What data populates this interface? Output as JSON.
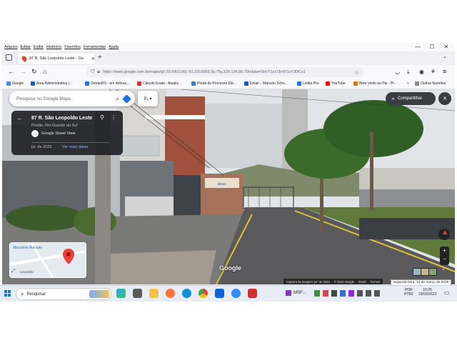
{
  "menubar": {
    "items": [
      "Arquivo",
      "Editar",
      "Exibir",
      "Histórico",
      "Favoritos",
      "Ferramentas",
      "Ajuda"
    ]
  },
  "browser": {
    "tab_title": "87 R. São Leopoldo Leste - Go",
    "url": "https://www.google.com.br/maps/@-29.6901183,-51.2310669,3a,75y,329.13h,89.79t/data=!3m7!1e1!3m5!1sY3DCs1",
    "bookmarks": [
      {
        "label": "Google",
        "color": "#4285f4"
      },
      {
        "label": "Área Administrativa |...",
        "color": "#1565c0"
      },
      {
        "label": "DetranRS - em defesa...",
        "color": "#1a73e8"
      },
      {
        "label": "Cálculo Exato - Atualiz...",
        "color": "#d93025"
      },
      {
        "label": "Portal do Processo Ele...",
        "color": "#3c78d8"
      },
      {
        "label": "Email – Marcelo Scho...",
        "color": "#0b57d0"
      },
      {
        "label": "Leilão Pro",
        "color": "#1a73e8"
      },
      {
        "label": "YouTube",
        "color": "#ff0000"
      },
      {
        "label": "Bem-vindo ao Pie - Pr...",
        "color": "#e37400"
      }
    ],
    "other_favorites": "Outros favoritos"
  },
  "maps": {
    "search_placeholder": "Pesquise no Google Maps",
    "share_label": "Compartilhar",
    "place_title": "87 R. São Leopoldo Leste",
    "place_subtitle": "Portão, Rio Grande do Sul",
    "provider": "Google Street View",
    "date": "jul. de 2023",
    "more_dates": "Ver mais datas",
    "minimap_label1": "Macromix Atacado",
    "minimap_label2": "Leopoldo",
    "watermark": "Google",
    "footer": [
      "Captura da imagem: jul. de 2023",
      "© 2023 Google",
      "Brasil",
      "Termos"
    ],
    "sign_text": "Resid."
  },
  "taskbar": {
    "search_label": "Pesquisar",
    "app_label": "MSF...",
    "lang": "POR",
    "lang2": "PTB2",
    "time": "10:25",
    "date": "10/03/2023",
    "tooltip": "segunda-feira, 10 de março de 2025"
  },
  "colors": {
    "accent": "#1a73e8",
    "sky": "#d9dde3",
    "building_red": "#a0503c",
    "road": "#5a5a5c",
    "grass": "#6b8a3a"
  }
}
